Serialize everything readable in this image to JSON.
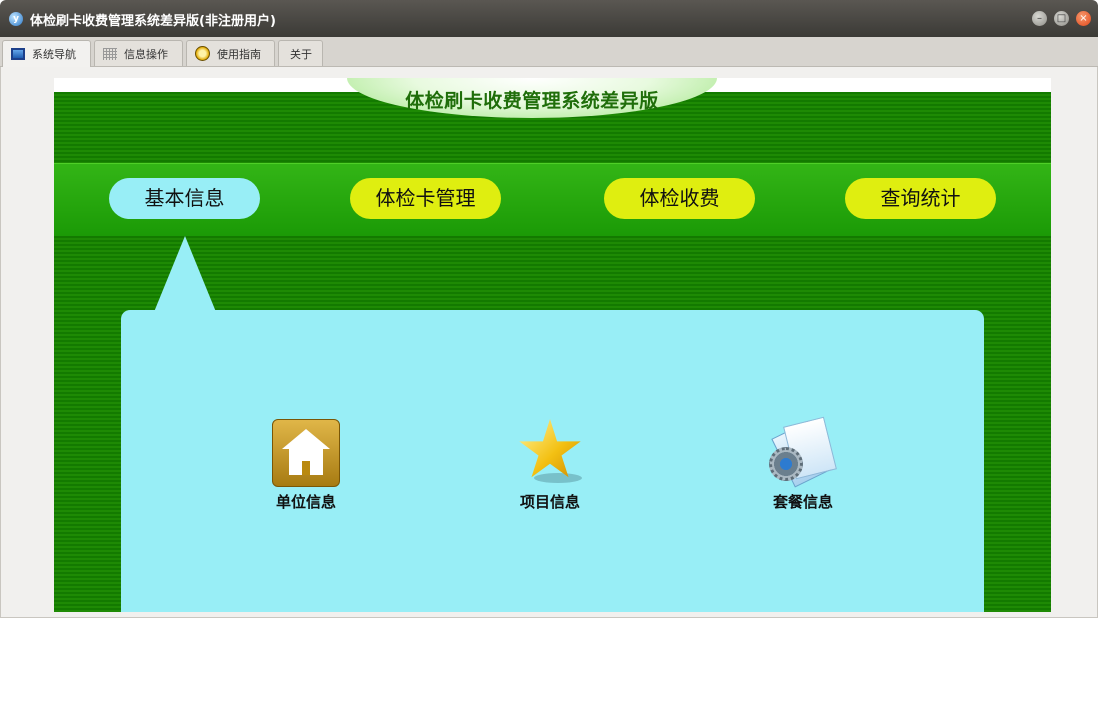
{
  "window": {
    "title": "体检刷卡收费管理系统差异版(非注册用户)",
    "app_icon": "yf-logo-icon",
    "controls": [
      "minimize-icon",
      "maximize-icon",
      "close-icon"
    ]
  },
  "tabs": [
    {
      "label": "系统导航",
      "icon": "monitor-icon",
      "active": true
    },
    {
      "label": "信息操作",
      "icon": "grid-icon",
      "active": false
    },
    {
      "label": "使用指南",
      "icon": "clock-icon",
      "active": false
    },
    {
      "label": "关于",
      "icon": "",
      "active": false
    }
  ],
  "panel": {
    "banner_title": "体检刷卡收费管理系统差异版",
    "nav": [
      {
        "label": "基本信息",
        "active": true
      },
      {
        "label": "体检卡管理",
        "active": false
      },
      {
        "label": "体检收费",
        "active": false
      },
      {
        "label": "查询统计",
        "active": false
      }
    ],
    "items": [
      {
        "label": "单位信息",
        "icon": "house-icon"
      },
      {
        "label": "项目信息",
        "icon": "star-icon"
      },
      {
        "label": "套餐信息",
        "icon": "document-gear-icon"
      }
    ]
  },
  "colors": {
    "panel_green": "#1e8a04",
    "nav_active": "#98eef6",
    "nav_inactive": "#dfee10",
    "card_bg": "#98eef6"
  }
}
